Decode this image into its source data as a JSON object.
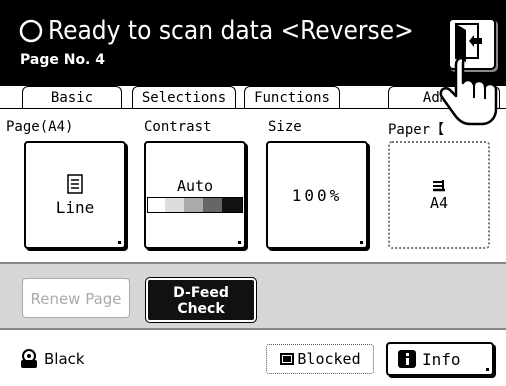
{
  "header": {
    "status": "Ready to scan data <Reverse>",
    "page_no": "Page No. 4",
    "exit_icon": "exit-door-icon"
  },
  "tabs": [
    {
      "label": "Basic"
    },
    {
      "label": "Selections"
    },
    {
      "label": "Functions"
    },
    {
      "label": "Admin"
    }
  ],
  "functions": {
    "page": {
      "label": "Page(A4)",
      "value": "Line"
    },
    "contrast": {
      "label": "Contrast",
      "value": "Auto"
    },
    "size": {
      "label": "Size",
      "value": "100%"
    },
    "paper": {
      "label": "Paper【",
      "value": "A4"
    }
  },
  "actions": {
    "renew_page": "Renew Page",
    "dfeed_line1": "D-Feed",
    "dfeed_line2": "Check"
  },
  "footer": {
    "ink": "Black",
    "blocked": "Blocked",
    "info": "Info"
  }
}
